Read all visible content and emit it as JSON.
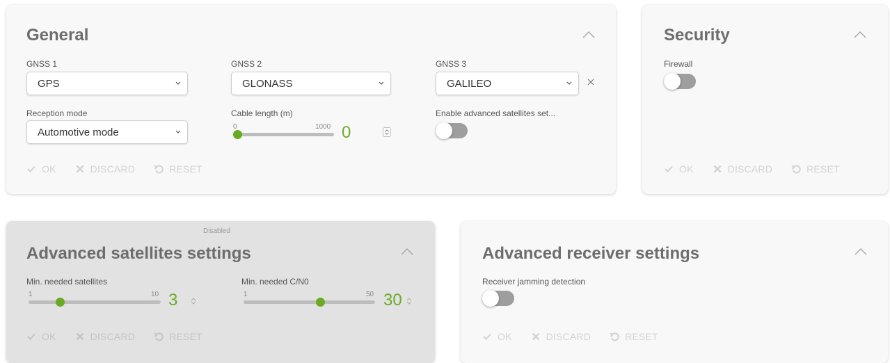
{
  "actions": {
    "ok": "OK",
    "discard": "DISCARD",
    "reset": "RESET"
  },
  "colors": {
    "accent": "#6aab24",
    "toggle_off": "#9e9e9e",
    "disabled_card": "#e2e2e2"
  },
  "general": {
    "title": "General",
    "gnss1": {
      "label": "GNSS 1",
      "value": "GPS"
    },
    "gnss2": {
      "label": "GNSS 2",
      "value": "GLONASS"
    },
    "gnss3": {
      "label": "GNSS 3",
      "value": "GALILEO"
    },
    "reception_mode": {
      "label": "Reception mode",
      "value": "Automotive mode"
    },
    "cable_length": {
      "label": "Cable length (m)",
      "min": "0",
      "max": "1000",
      "value": "0",
      "fraction": 0.0
    },
    "enable_advanced": {
      "label": "Enable advanced satellites set...",
      "on": false
    }
  },
  "security": {
    "title": "Security",
    "firewall": {
      "label": "Firewall",
      "on": false
    }
  },
  "advanced_satellites": {
    "status": "Disabled",
    "title": "Advanced satellites settings",
    "min_satellites": {
      "label": "Min. needed satellites",
      "min": "1",
      "max": "10",
      "value": "3",
      "fraction": 0.22
    },
    "min_cn0": {
      "label": "Min. needed C/N0",
      "min": "1",
      "max": "50",
      "value": "30",
      "fraction": 0.59
    }
  },
  "advanced_receiver": {
    "title": "Advanced receiver settings",
    "jamming": {
      "label": "Receiver jamming detection",
      "on": false
    }
  }
}
